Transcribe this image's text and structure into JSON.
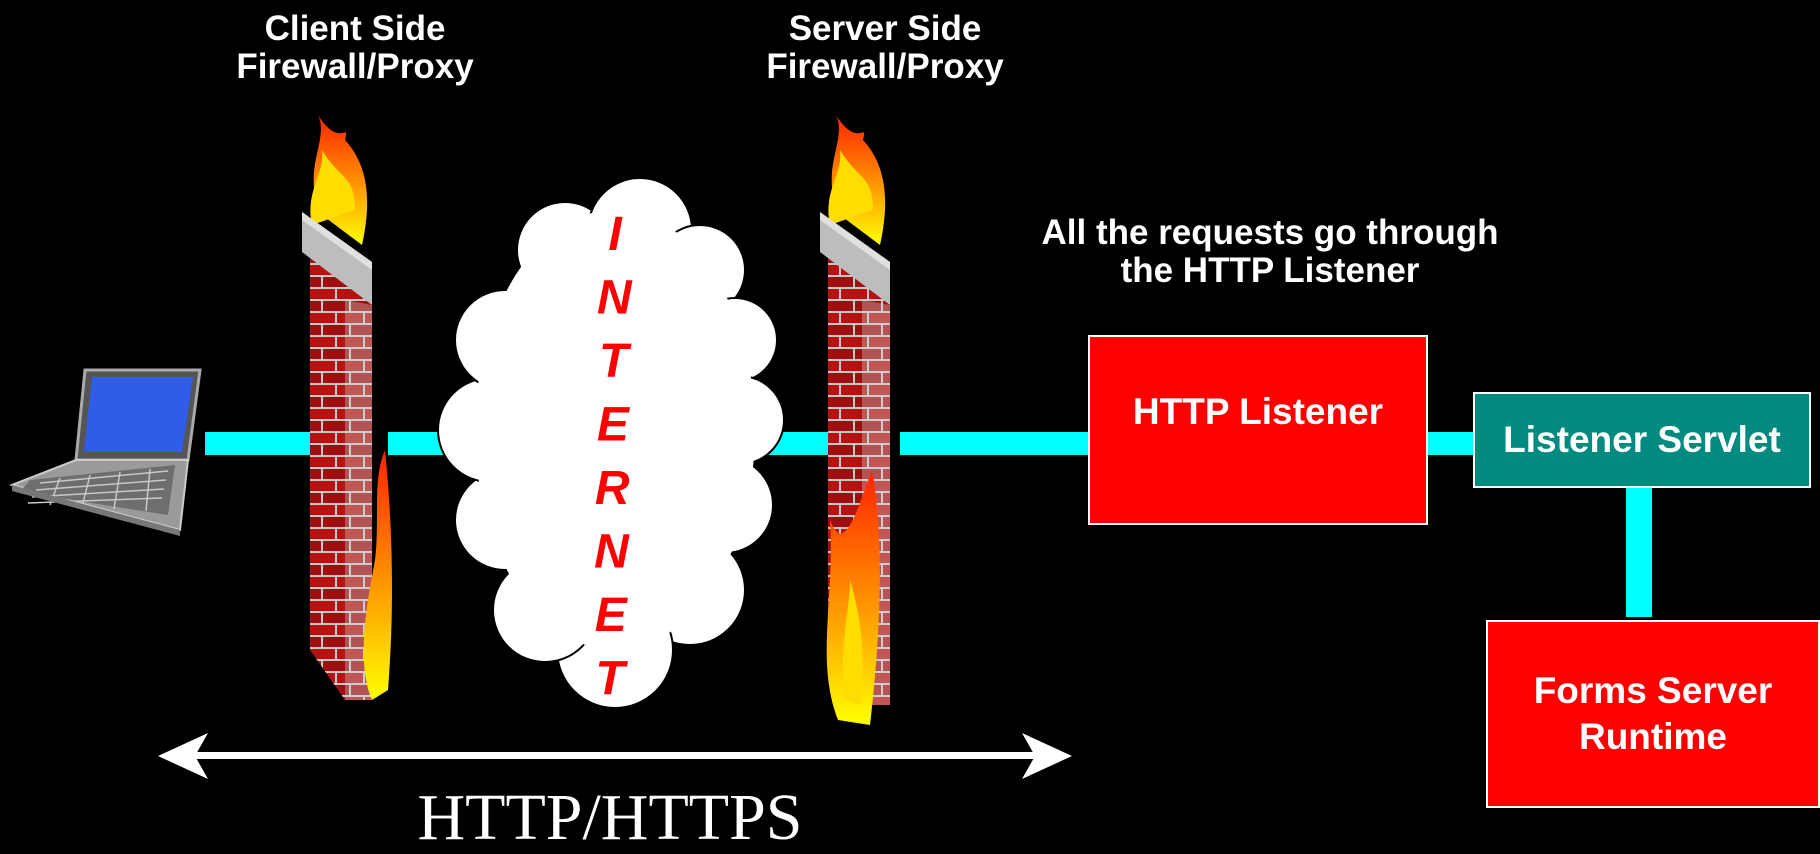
{
  "labels": {
    "client_firewall": "Client Side\nFirewall/Proxy",
    "server_firewall": "Server Side\nFirewall/Proxy",
    "note": "All the requests go through\nthe HTTP Listener",
    "protocol": "HTTP/HTTPS"
  },
  "cloud_text": "INTERNET",
  "boxes": {
    "http_listener": "HTTP Listener",
    "listener_servlet": "Listener Servlet",
    "forms_runtime": "Forms Server\nRuntime"
  },
  "colors": {
    "background": "#000000",
    "connector": "#00ffff",
    "http_listener_fill": "#ff0000",
    "listener_servlet_fill": "#008a80",
    "forms_runtime_fill": "#ff0000",
    "cloud_text": "#ff0000",
    "arrow": "#ffffff"
  },
  "icons": [
    "laptop-icon",
    "firewall-icon",
    "cloud-icon"
  ]
}
